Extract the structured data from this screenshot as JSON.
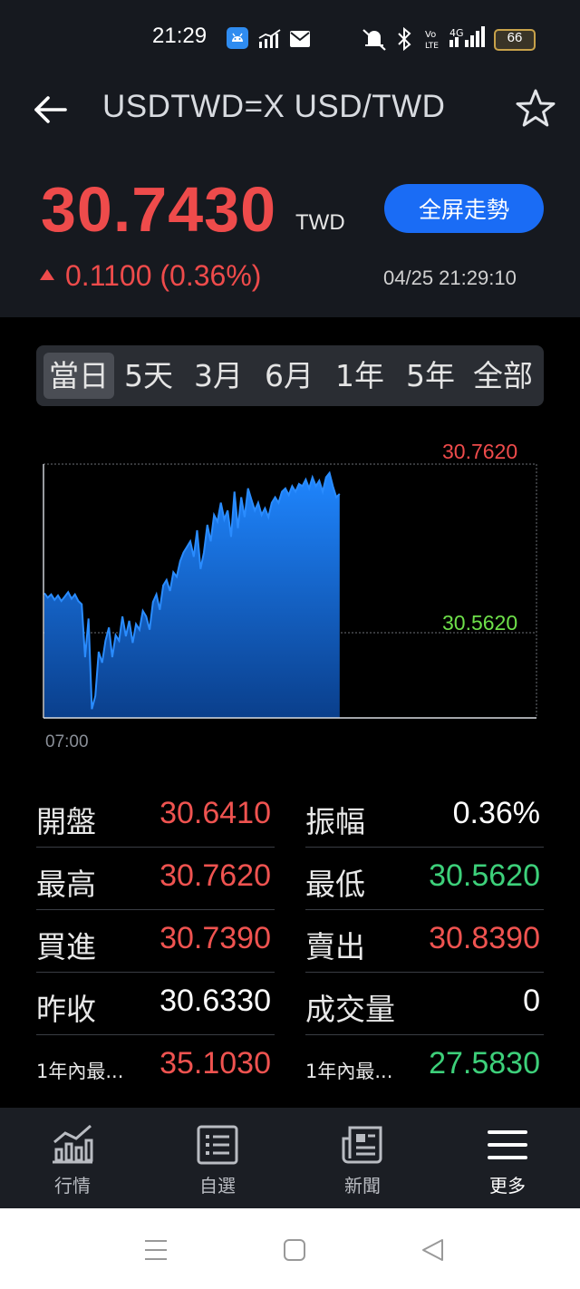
{
  "status_bar": {
    "time": "21:29",
    "battery": "66"
  },
  "header": {
    "title": "USDTWD=X USD/TWD",
    "price": "30.7430",
    "unit": "TWD",
    "fullscreen_label": "全屏走勢",
    "change": "0.1100 (0.36%)",
    "timestamp": "04/25 21:29:10"
  },
  "range_tabs": [
    {
      "label": "當日",
      "active": true
    },
    {
      "label": "5天"
    },
    {
      "label": "3月"
    },
    {
      "label": "6月"
    },
    {
      "label": "1年"
    },
    {
      "label": "5年"
    },
    {
      "label": "全部"
    }
  ],
  "chart_data": {
    "type": "area",
    "high_label": "30.7620",
    "low_label": "30.5620",
    "x_start_label": "07:00",
    "ylim": [
      30.54,
      30.77
    ],
    "session_fraction_elapsed": 0.6,
    "values": [
      30.653,
      30.649,
      30.652,
      30.647,
      30.651,
      30.646,
      30.65,
      30.654,
      30.648,
      30.652,
      30.646,
      30.643,
      30.595,
      30.63,
      30.548,
      30.56,
      30.6,
      30.59,
      30.61,
      30.622,
      30.595,
      30.615,
      30.61,
      30.632,
      30.614,
      30.628,
      30.608,
      30.625,
      30.62,
      30.637,
      30.632,
      30.62,
      30.645,
      30.652,
      30.638,
      30.66,
      30.665,
      30.655,
      30.672,
      30.668,
      30.682,
      30.69,
      30.695,
      30.7,
      30.686,
      30.71,
      30.675,
      30.69,
      30.715,
      30.7,
      30.724,
      30.718,
      30.735,
      30.72,
      30.728,
      30.704,
      30.745,
      30.712,
      30.74,
      30.722,
      30.748,
      30.738,
      30.728,
      30.735,
      30.724,
      30.73,
      30.722,
      30.735,
      30.74,
      30.735,
      30.745,
      30.748,
      30.742,
      30.75,
      30.745,
      30.752,
      30.75,
      30.756,
      30.748,
      30.758,
      30.75,
      30.755,
      30.745,
      30.758,
      30.762,
      30.75,
      30.74,
      30.743
    ]
  },
  "stats": [
    {
      "left_label": "開盤",
      "left_value": "30.6410",
      "left_color": "#ef5350",
      "right_label": "振幅",
      "right_value": "0.36%",
      "right_color": "#ffffff"
    },
    {
      "left_label": "最高",
      "left_value": "30.7620",
      "left_color": "#ef5350",
      "right_label": "最低",
      "right_value": "30.5620",
      "right_color": "#3dd07a"
    },
    {
      "left_label": "買進",
      "left_value": "30.7390",
      "left_color": "#ef5350",
      "right_label": "賣出",
      "right_value": "30.8390",
      "right_color": "#ef5350"
    },
    {
      "left_label": "昨收",
      "left_value": "30.6330",
      "left_color": "#ffffff",
      "right_label": "成交量",
      "right_value": "0",
      "right_color": "#ffffff"
    },
    {
      "left_label": "1年內最...",
      "left_value": "35.1030",
      "left_color": "#ef5350",
      "right_label": "1年內最...",
      "right_value": "27.5830",
      "right_color": "#3dd07a"
    }
  ],
  "bottom_nav": [
    {
      "label": "行情",
      "icon": "market-chart-icon"
    },
    {
      "label": "自選",
      "icon": "watchlist-icon"
    },
    {
      "label": "新聞",
      "icon": "news-icon"
    },
    {
      "label": "更多",
      "icon": "menu-icon",
      "active": true
    }
  ],
  "colors": {
    "up": "#ef5350",
    "down": "#3dd07a",
    "accent": "#1a6cf5"
  }
}
